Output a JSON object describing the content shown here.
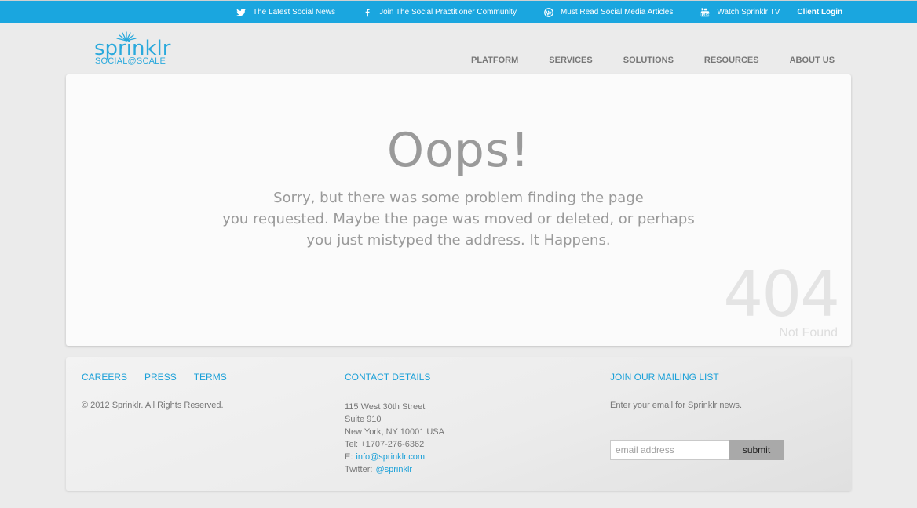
{
  "topbar": {
    "links": [
      {
        "label": "The Latest Social News",
        "icon": "twitter-icon"
      },
      {
        "label": "Join The Social Practitioner Community",
        "icon": "facebook-icon"
      },
      {
        "label": "Must Read Social Media Articles",
        "icon": "wordpress-icon"
      },
      {
        "label": "Watch Sprinklr TV",
        "icon": "youtube-icon"
      }
    ],
    "client_login": "Client Login",
    "bg_color": "#1aa6df"
  },
  "logo": {
    "wordmark": "sprinklr",
    "tagline": "SOCIAL@SCALE",
    "color": "#2aa9dc"
  },
  "nav": {
    "items": [
      "PLATFORM",
      "SERVICES",
      "SOLUTIONS",
      "RESOURCES",
      "ABOUT US"
    ]
  },
  "error": {
    "heading": "Oops!",
    "message_lines": [
      "Sorry, but there was some problem finding the page",
      "you requested. Maybe the page was moved or deleted, or perhaps",
      "you just mistyped the address. It Happens."
    ],
    "code": "404",
    "code_label": "Not Found"
  },
  "footer": {
    "links": [
      "CAREERS",
      "PRESS",
      "TERMS"
    ],
    "copyright": "© 2012 Sprinklr. All Rights Reserved.",
    "contact": {
      "heading": "CONTACT DETAILS",
      "street": "115 West 30th Street",
      "suite": "Suite 910",
      "city": "New York, NY 10001 USA",
      "tel": "Tel: +1707-276-6362",
      "email_label": "E:",
      "email": "info@sprinklr.com",
      "twitter_label": "Twitter:",
      "twitter": "@sprinklr"
    },
    "mailing": {
      "heading": "JOIN OUR MAILING LIST",
      "description": "Enter your email for Sprinklr news.",
      "placeholder": "email address",
      "submit": "submit"
    }
  }
}
